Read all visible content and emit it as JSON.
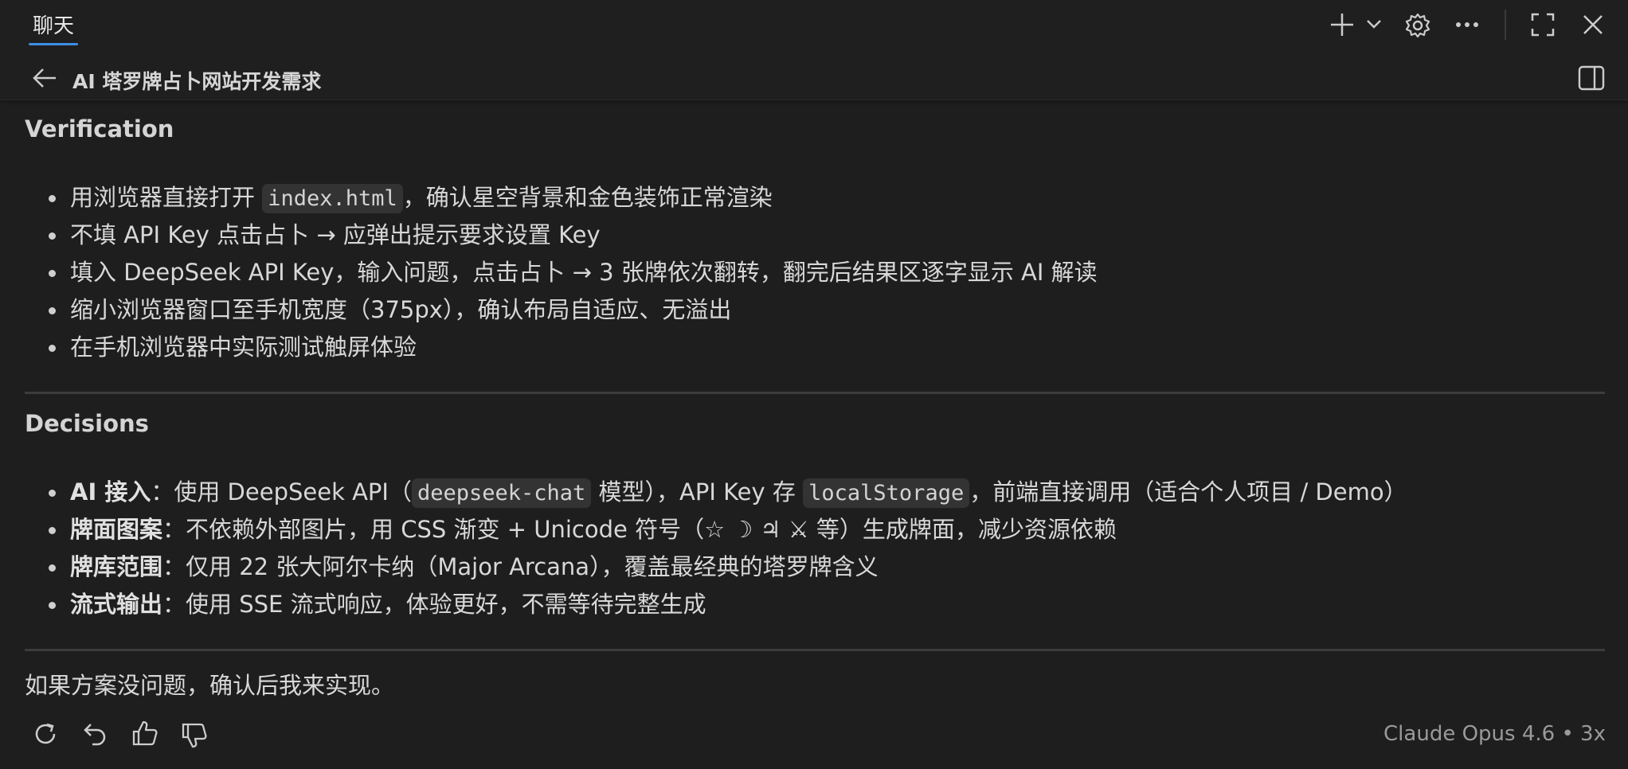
{
  "tab": {
    "label": "聊天"
  },
  "header": {
    "title": "AI 塔罗牌占卜网站开发需求"
  },
  "verification": {
    "heading": "Verification",
    "items": [
      {
        "pre": "用浏览器直接打开 ",
        "code": "index.html",
        "post": "，确认星空背景和金色装饰正常渲染"
      },
      {
        "text": "不填 API Key 点击占卜 → 应弹出提示要求设置 Key"
      },
      {
        "text": "填入 DeepSeek API Key，输入问题，点击占卜 → 3 张牌依次翻转，翻完后结果区逐字显示 AI 解读"
      },
      {
        "text": "缩小浏览器窗口至手机宽度（375px），确认布局自适应、无溢出"
      },
      {
        "text": "在手机浏览器中实际测试触屏体验"
      }
    ]
  },
  "decisions": {
    "heading": "Decisions",
    "items": [
      {
        "bold": "AI 接入",
        "pre": "：使用 DeepSeek API（",
        "code": "deepseek-chat",
        "mid": " 模型），API Key 存 ",
        "code2": "localStorage",
        "post": "，前端直接调用（适合个人项目 / Demo）"
      },
      {
        "bold": "牌面图案",
        "text": "：不依赖外部图片，用 CSS 渐变 + Unicode 符号（☆ ☽ ♃ ⚔ 等）生成牌面，减少资源依赖"
      },
      {
        "bold": "牌库范围",
        "text": "：仅用 22 张大阿尔卡纳（Major Arcana），覆盖最经典的塔罗牌含义"
      },
      {
        "bold": "流式输出",
        "text": "：使用 SSE 流式响应，体验更好，不需等待完整生成"
      }
    ]
  },
  "final_message": "如果方案没问题，确认后我来实现。",
  "footer": {
    "model_label": "Claude Opus 4.6 • 3x"
  },
  "colors": {
    "accent": "#3c8ee6",
    "background": "#1e1e1e",
    "text": "#cccccc"
  }
}
